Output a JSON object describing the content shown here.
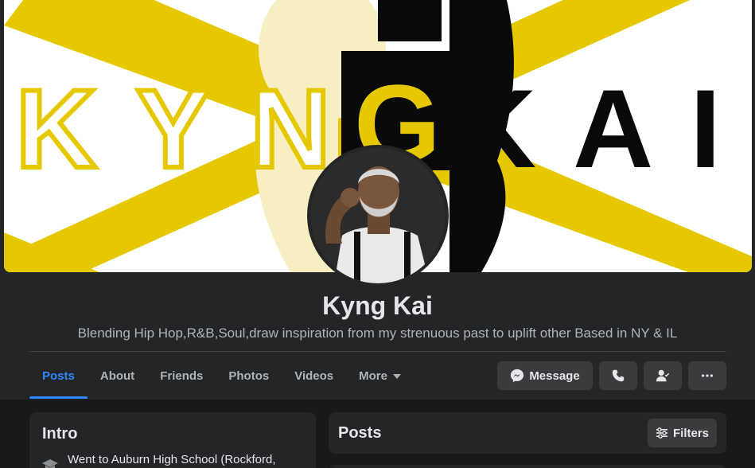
{
  "profile": {
    "name": "Kyng Kai",
    "bio": "Blending Hip Hop,R&B,Soul,draw inspiration from my strenuous past to uplift other Based in NY & IL"
  },
  "cover": {
    "logo_letters_left": "KYN",
    "logo_letter_g": "G",
    "logo_letters_right": "KAI",
    "colors": {
      "yellow": "#e5c800",
      "black": "#0a0a0a"
    }
  },
  "tabs": [
    {
      "label": "Posts",
      "active": true
    },
    {
      "label": "About"
    },
    {
      "label": "Friends"
    },
    {
      "label": "Photos"
    },
    {
      "label": "Videos"
    },
    {
      "label": "More"
    }
  ],
  "actions": {
    "message_label": "Message",
    "call_icon": "phone-icon",
    "friend_icon": "friends-icon",
    "more_icon": "ellipsis-icon"
  },
  "intro": {
    "title": "Intro",
    "education": "Went to Auburn High School (Rockford,",
    "education_icon": "graduation-cap-icon"
  },
  "posts": {
    "title": "Posts",
    "filters_label": "Filters",
    "filters_icon": "filters-icon"
  },
  "colors": {
    "background": "#18191a",
    "surface": "#242526",
    "button": "#3a3b3c",
    "accent": "#2d88ff",
    "text_primary": "#e4e6eb",
    "text_secondary": "#b0b3b8"
  }
}
